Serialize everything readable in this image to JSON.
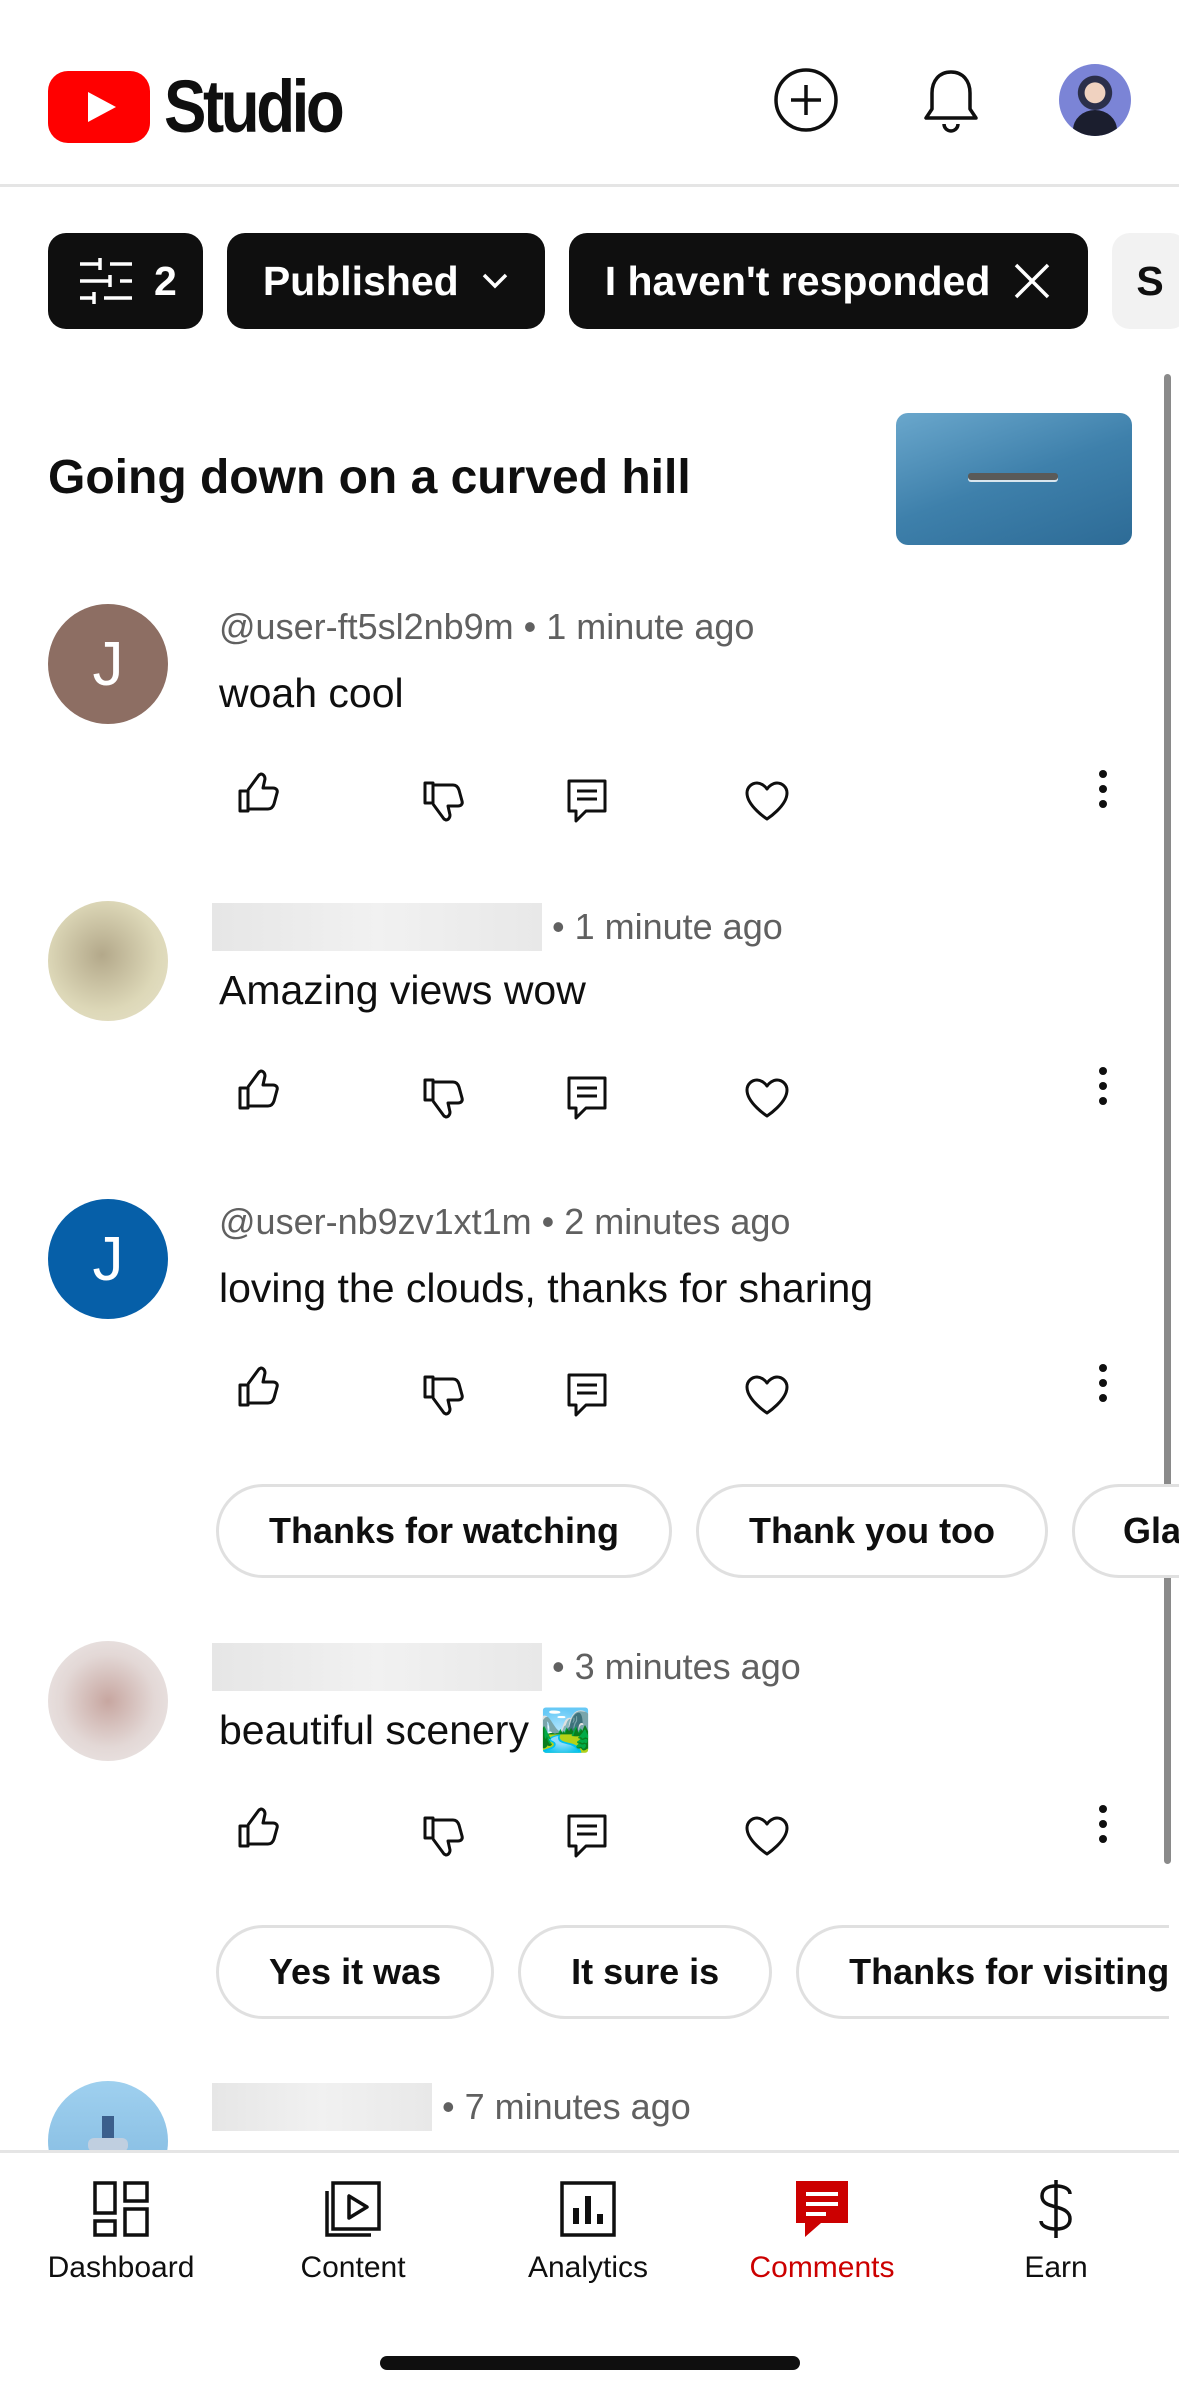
{
  "app": {
    "name": "Studio"
  },
  "header": {
    "create_icon": "plus-circle-icon",
    "notifications_icon": "bell-icon",
    "account_icon": "avatar"
  },
  "filters": {
    "filter_count": "2",
    "published": "Published",
    "responded": "I haven't responded",
    "partial": "S"
  },
  "video": {
    "title": "Going down on a curved hill"
  },
  "comments": [
    {
      "author": "@user-ft5sl2nb9m",
      "time": "• 1 minute ago",
      "text": "woah cool",
      "initial": "J",
      "avatar_color": "#8d6e63"
    },
    {
      "author": "",
      "time": "• 1 minute ago",
      "text": "Amazing views wow",
      "initial": "",
      "avatar_color": "#d8d3b0"
    },
    {
      "author": "@user-nb9zv1xt1m",
      "time": "• 2 minutes ago",
      "text": "loving the clouds, thanks for sharing",
      "initial": "J",
      "avatar_color": "#065fa8",
      "suggested_replies": [
        "Thanks for watching",
        "Thank you too",
        "Gla"
      ]
    },
    {
      "author": "",
      "time": "• 3 minutes ago",
      "text": "beautiful scenery 🏞️",
      "initial": "",
      "avatar_color": "#e3d8d6",
      "suggested_replies": [
        "Yes it was",
        "It sure is",
        "Thanks for visiting"
      ]
    },
    {
      "author": "",
      "time": "• 7 minutes ago",
      "text": "",
      "initial": "",
      "avatar_color": "#8fc3e6"
    }
  ],
  "nav": [
    {
      "label": "Dashboard",
      "icon": "dashboard-icon"
    },
    {
      "label": "Content",
      "icon": "content-icon"
    },
    {
      "label": "Analytics",
      "icon": "analytics-icon"
    },
    {
      "label": "Comments",
      "icon": "comments-icon",
      "active": true
    },
    {
      "label": "Earn",
      "icon": "dollar-icon"
    }
  ],
  "colors": {
    "accent": "#cc0000",
    "brand": "#ff0000",
    "chip_bg": "#0f0f0f"
  }
}
